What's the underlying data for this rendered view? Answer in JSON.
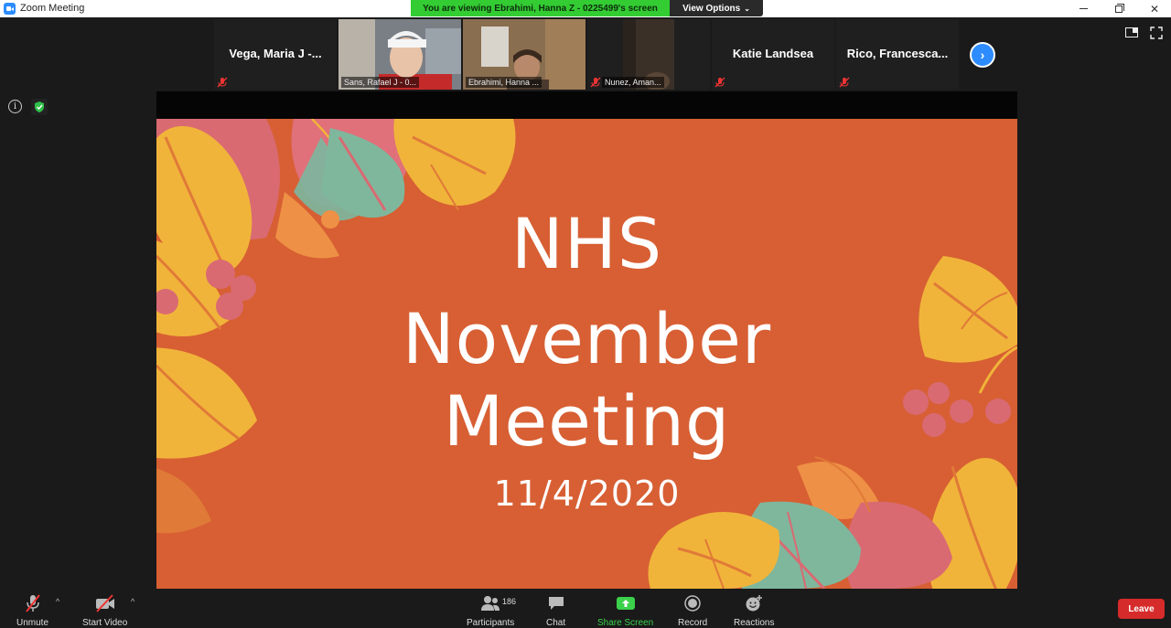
{
  "window": {
    "title": "Zoom Meeting"
  },
  "banner": {
    "viewing": "You are viewing Ebrahimi, Hanna Z - 0225499's screen",
    "view_options": "View Options"
  },
  "participants": [
    {
      "name": "Vega, Maria J -...",
      "video": false
    },
    {
      "name": "Sans, Rafael J - 0...",
      "video": true
    },
    {
      "name": "Ebrahimi, Hanna ...",
      "video": true,
      "active": true
    },
    {
      "name": "Nunez, Aman...",
      "video": true
    },
    {
      "name": "Katie Landsea",
      "video": false
    },
    {
      "name": "Rico,  Francesca...",
      "video": false
    }
  ],
  "slide": {
    "line1": "NHS",
    "line2": "November",
    "line3": "Meeting",
    "date": "11/4/2020",
    "background": "#d75f33"
  },
  "toolbar": {
    "unmute": "Unmute",
    "start_video": "Start Video",
    "participants": "Participants",
    "participant_count": "186",
    "chat": "Chat",
    "share_screen": "Share Screen",
    "record": "Record",
    "reactions": "Reactions",
    "leave": "Leave"
  },
  "icons": [
    "zoom-app-icon",
    "info-icon",
    "shield-icon",
    "gallery-layout-icon",
    "fullscreen-icon",
    "next-page-icon",
    "mic-muted-icon",
    "video-off-icon",
    "participants-icon",
    "chat-icon",
    "share-screen-icon",
    "record-icon",
    "reactions-icon"
  ],
  "colors": {
    "accent": "#2d8cff",
    "share_green": "#3bd14b",
    "leave_red": "#d62b2b",
    "banner_green": "#33cc33"
  }
}
